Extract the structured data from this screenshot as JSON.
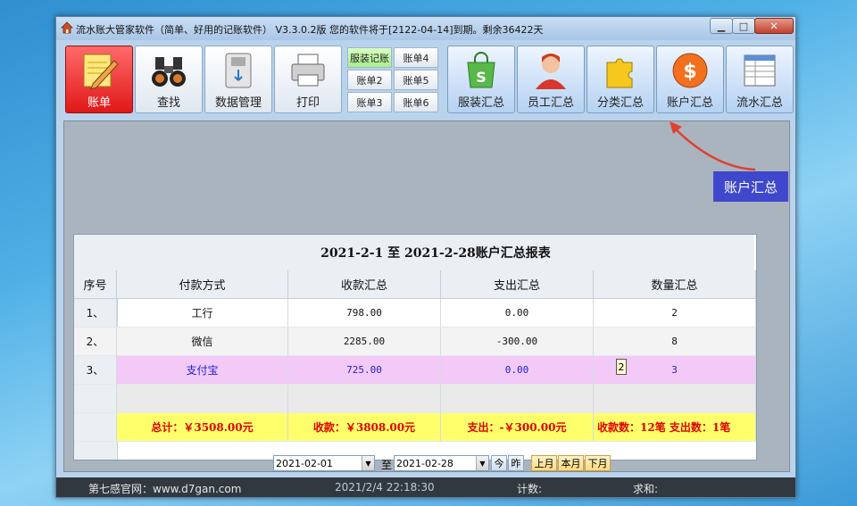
{
  "window": {
    "title": "流水账大管家软件（简单、好用的记账软件） V3.3.0.2版 您的软件将于[2122-04-14]到期。剩余36422天",
    "controls": {
      "minimize": "▁",
      "maximize": "□",
      "close": "✕"
    }
  },
  "toolbar": {
    "zhangdan": "账单",
    "chazhao": "查找",
    "shuju": "数据管理",
    "dayin": "打印",
    "ledgers": [
      "服装记账",
      "账单4",
      "账单2",
      "账单5",
      "账单3",
      "账单6"
    ],
    "fuzhuang": "服装汇总",
    "yuangong": "员工汇总",
    "fenlei": "分类汇总",
    "zhanghu": "账户汇总",
    "liushui": "流水汇总"
  },
  "report": {
    "title": "2021-2-1  至  2021-2-28账户汇总报表",
    "headers": [
      "序号",
      "付款方式",
      "收款汇总",
      "支出汇总",
      "数量汇总"
    ],
    "rows": [
      {
        "idx": "1、",
        "method": "工行",
        "income": "798.00",
        "expense": "0.00",
        "count": "2"
      },
      {
        "idx": "2、",
        "method": "微信",
        "income": "2285.00",
        "expense": "-300.00",
        "count": "8"
      },
      {
        "idx": "3、",
        "method": "支付宝",
        "income": "725.00",
        "expense": "0.00",
        "count": "3"
      }
    ],
    "totals": {
      "total": "总计：￥3508.00元",
      "income": "收款：￥3808.00元",
      "expense": "支出：-￥300.00元",
      "counts": "收款数：12笔  支出数：1笔"
    },
    "cell_marker": "2"
  },
  "bottombar": {
    "date_from": "2021-02-01",
    "to": "至",
    "date_to": "2021-02-28",
    "today": "今",
    "yesterday": "昨",
    "prev_month": "上月",
    "this_month": "本月",
    "next_month": "下月"
  },
  "status": {
    "site": "第七感官网：www.d7gan.com",
    "datetime": "2021/2/4 22:18:30",
    "count_label": "计数:",
    "sum_label": "求和:"
  },
  "callout": "账户汇总",
  "colors": {
    "active_red": "#e01818",
    "highlight_row": "#f3c9f7",
    "total_row": "#ffff6b",
    "callout": "#3f48cc"
  }
}
